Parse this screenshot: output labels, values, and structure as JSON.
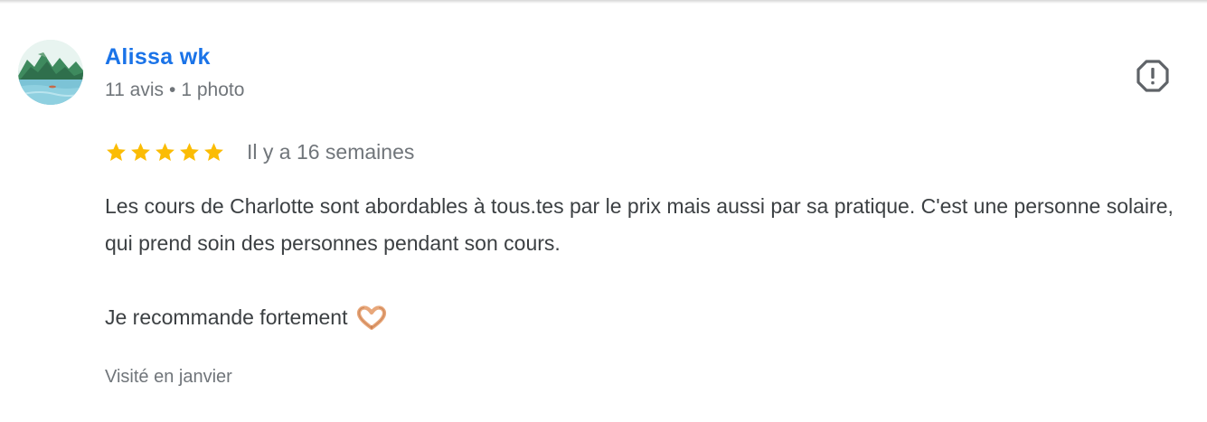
{
  "review": {
    "author": {
      "name": "Alissa wk",
      "reviews_count": "11 avis",
      "separator": "•",
      "photos_count": "1 photo",
      "avatar_icon": "landscape-avatar"
    },
    "rating": {
      "value": 5,
      "max": 5,
      "star_color": "#fbbc04"
    },
    "date": "Il y a 16 semaines",
    "text": {
      "paragraph_1": "Les cours de Charlotte sont abordables à tous.tes par le prix mais aussi par sa pratique. C'est une personne solaire, qui prend soin des personnes pendant son cours.",
      "paragraph_2": "Je recommande fortement",
      "emoji_icon": "heart-hands-emoji"
    },
    "visited": "Visité en janvier",
    "report_icon": "report-octagon-icon",
    "colors": {
      "author_link": "#1a73e8",
      "secondary_text": "#70757a",
      "body_text": "#3c4043"
    }
  }
}
